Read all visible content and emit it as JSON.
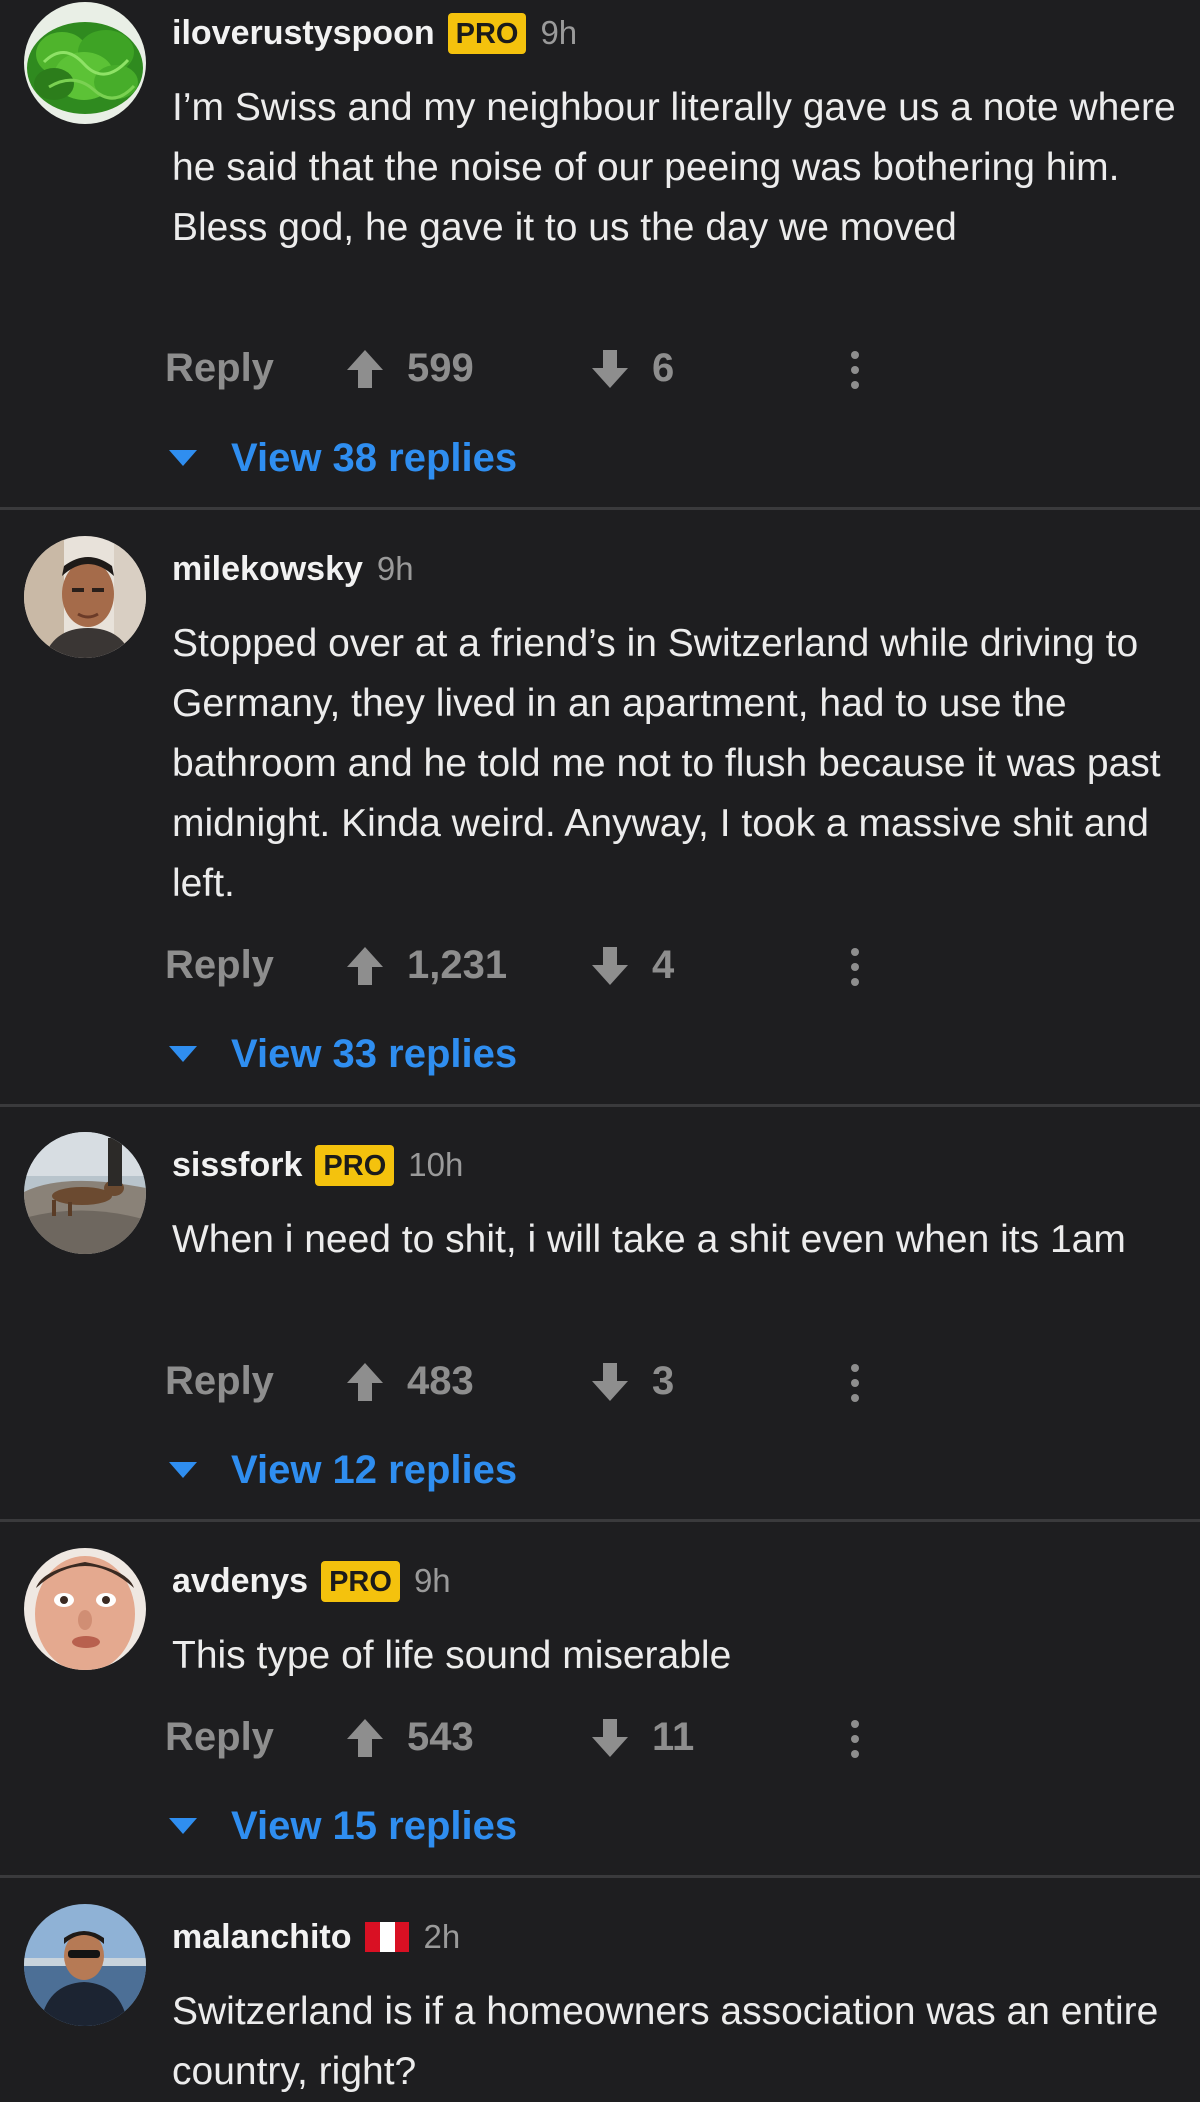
{
  "colors": {
    "background": "#1e1e20",
    "divider": "#3a3a3c",
    "username": "#f2f2f2",
    "body_text": "#ececec",
    "meta_gray": "#8e8e8e",
    "pro_badge": "#f4c20d",
    "link_blue": "#2f8ef0"
  },
  "icons": {
    "upvote": "arrow-up-icon",
    "downvote": "arrow-down-icon",
    "more": "vertical-ellipsis-icon",
    "expand": "triangle-down-icon"
  },
  "comments": [
    {
      "username": "iloverustyspoon",
      "badge": "PRO",
      "time": "9h",
      "text": "I’m Swiss and my neighbour literally gave us a note where he said that the noise of our peeing was bothering him. Bless god, he gave it to us the day we moved",
      "reply_label": "Reply",
      "upvotes": "599",
      "downvotes": "6",
      "replies_label": "View 38 replies",
      "avatar": "lettuce-avatar"
    },
    {
      "username": "milekowsky",
      "time": "9h",
      "text": "Stopped over at a friend’s in Switzerland while driving to Germany, they lived in an apartment, had to use the bathroom and he told me not to flush because it was past midnight. Kinda weird. Anyway, I took a massive shit and left.",
      "reply_label": "Reply",
      "upvotes": "1,231",
      "downvotes": "4",
      "replies_label": "View 33 replies",
      "avatar": "man-portrait-avatar"
    },
    {
      "username": "sissfork",
      "badge": "PRO",
      "time": "10h",
      "text": "When i need to shit, i will take a shit even when its 1am",
      "reply_label": "Reply",
      "upvotes": "483",
      "downvotes": "3",
      "replies_label": "View 12 replies",
      "avatar": "animal-on-rock-avatar"
    },
    {
      "username": "avdenys",
      "badge": "PRO",
      "time": "9h",
      "text": "This type of life sound miserable",
      "reply_label": "Reply",
      "upvotes": "543",
      "downvotes": "11",
      "replies_label": "View 15 replies",
      "avatar": "face-closeup-avatar"
    },
    {
      "username": "malanchito",
      "flag": "peru-flag-icon",
      "flag_colors": [
        "#d91023",
        "#ffffff",
        "#d91023"
      ],
      "time": "2h",
      "text": "Switzerland is if a homeowners association was an entire country, right?",
      "avatar": "man-harbor-avatar"
    }
  ]
}
